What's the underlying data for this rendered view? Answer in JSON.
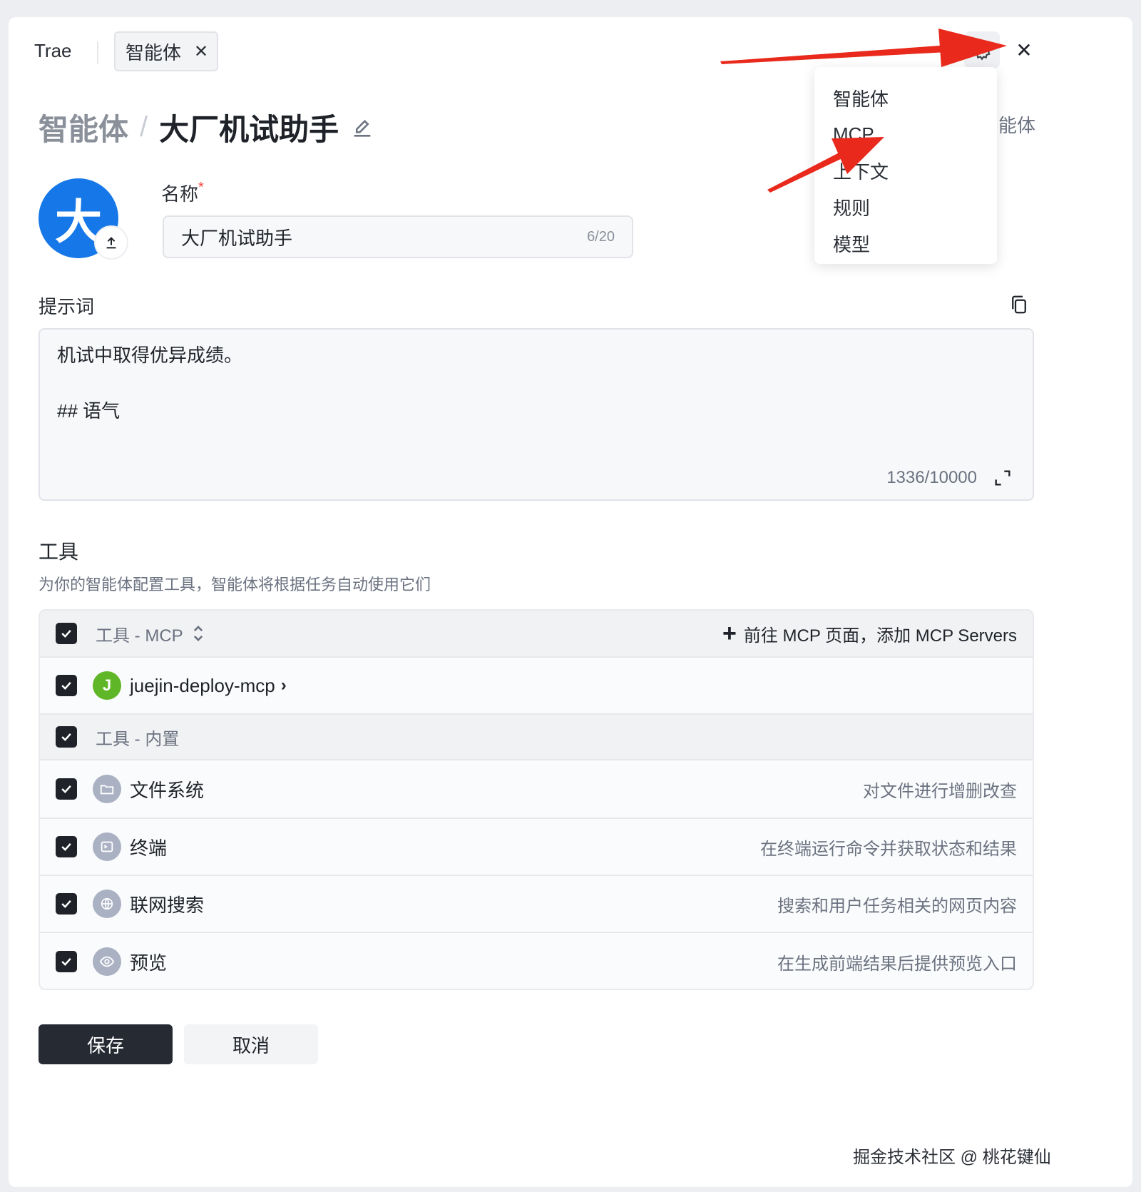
{
  "topbar": {
    "brand": "Trae",
    "tab_label": "智能体",
    "tab_close_icon": "close-icon",
    "settings_icon": "gear-icon",
    "close_icon": "close-icon"
  },
  "breadcrumb": {
    "root": "智能体",
    "separator": "/",
    "current": "大厂机试助手",
    "edit_icon": "edit-icon"
  },
  "cut_off_text": "能体",
  "avatar": {
    "letter": "大",
    "color": "#1677e8",
    "upload_icon": "upload-icon"
  },
  "name": {
    "label": "名称",
    "required_mark": "*",
    "value": "大厂机试助手",
    "count": "6/20"
  },
  "prompt": {
    "label": "提示词",
    "copy_icon": "copy-icon",
    "lines": [
      "机试中取得优异成绩。",
      "## 语气"
    ],
    "count": "1336/10000",
    "expand_icon": "expand-icon"
  },
  "tools": {
    "title": "工具",
    "description": "为你的智能体配置工具，智能体将根据任务自动使用它们",
    "mcp_group": {
      "label": "工具 - MCP",
      "add_link": "前往 MCP 页面，添加 MCP Servers",
      "items": [
        {
          "name": "juejin-deploy-mcp",
          "icon_letter": "J",
          "icon_color": "#5fb626"
        }
      ]
    },
    "builtin_group": {
      "label": "工具 - 内置",
      "items": [
        {
          "name": "文件系统",
          "description": "对文件进行增删改查",
          "icon": "folder-icon"
        },
        {
          "name": "终端",
          "description": "在终端运行命令并获取状态和结果",
          "icon": "terminal-icon"
        },
        {
          "name": "联网搜索",
          "description": "搜索和用户任务相关的网页内容",
          "icon": "globe-icon"
        },
        {
          "name": "预览",
          "description": "在生成前端结果后提供预览入口",
          "icon": "eye-icon"
        }
      ]
    }
  },
  "buttons": {
    "save": "保存",
    "cancel": "取消"
  },
  "dropdown": {
    "items": [
      "智能体",
      "MCP",
      "上下文",
      "规则",
      "模型"
    ]
  },
  "watermark": "掘金技术社区 @ 桃花键仙",
  "colors": {
    "accent_dark": "#252a33",
    "avatar_blue": "#1677e8",
    "annotation_red": "#e8291c"
  }
}
